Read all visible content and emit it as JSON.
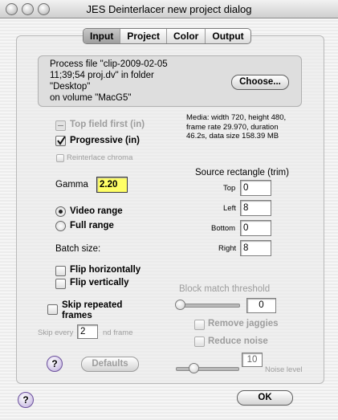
{
  "window": {
    "title": "JES Deinterlacer new project dialog"
  },
  "tabs": [
    "Input",
    "Project",
    "Color",
    "Output"
  ],
  "file": {
    "text": "Process file \"clip-2009-02-05\n11;39;54 proj.dv\" in folder\n\"Desktop\"\n    on volume \"MacG5\"",
    "choose_label": "Choose..."
  },
  "media_info": "Media: width 720, height 480,\nframe rate 29.970, duration\n46.2s, data size 158.39 MB",
  "options": {
    "top_field_first": "Top field first (in)",
    "progressive": "Progressive (in)",
    "reinterlace": "Reinterlace chroma"
  },
  "gamma": {
    "label": "Gamma",
    "value": "2.20"
  },
  "range": {
    "video": "Video range",
    "full": "Full range"
  },
  "batch_label": "Batch size:",
  "flip": {
    "horizontal": "Flip horizontally",
    "vertical": "Flip vertically"
  },
  "skip": {
    "label": "Skip repeated\nframes",
    "every_prefix": "Skip every",
    "every_value": "2",
    "every_suffix": "nd frame"
  },
  "source_rect": {
    "title": "Source rectangle (trim)",
    "top_label": "Top",
    "top": "0",
    "left_label": "Left",
    "left": "8",
    "bottom_label": "Bottom",
    "bottom": "0",
    "right_label": "Right",
    "right": "8"
  },
  "block_match": {
    "label": "Block match threshold",
    "value": "0"
  },
  "remove_jaggies": "Remove jaggies",
  "reduce_noise": "Reduce noise",
  "noise": {
    "value": "10",
    "label": "Noise level"
  },
  "buttons": {
    "defaults": "Defaults",
    "ok": "OK",
    "help": "?"
  },
  "colors": {
    "gamma_field": "#ffff66"
  }
}
